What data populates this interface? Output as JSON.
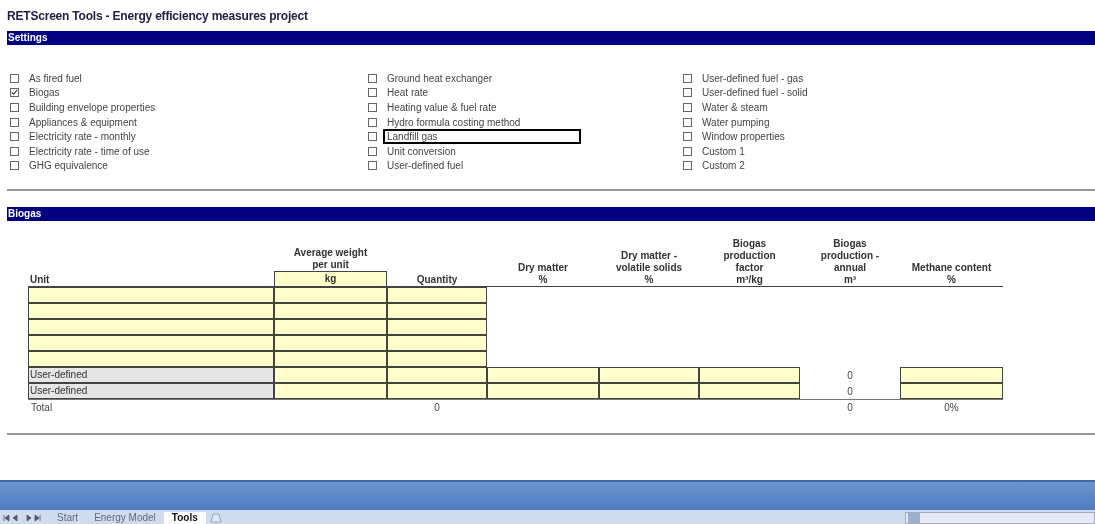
{
  "title": "RETScreen Tools - Energy efficiency measures project",
  "settings": {
    "heading": "Settings",
    "columns": [
      [
        {
          "label": "As fired fuel",
          "checked": false,
          "selected": false
        },
        {
          "label": "Biogas",
          "checked": true,
          "selected": false
        },
        {
          "label": "Building envelope properties",
          "checked": false,
          "selected": false
        },
        {
          "label": "Appliances & equipment",
          "checked": false,
          "selected": false
        },
        {
          "label": "Electricity rate - monthly",
          "checked": false,
          "selected": false
        },
        {
          "label": "Electricity rate - time of use",
          "checked": false,
          "selected": false
        },
        {
          "label": "GHG equivalence",
          "checked": false,
          "selected": false
        }
      ],
      [
        {
          "label": "Ground heat exchanger",
          "checked": false,
          "selected": false
        },
        {
          "label": "Heat rate",
          "checked": false,
          "selected": false
        },
        {
          "label": "Heating value & fuel rate",
          "checked": false,
          "selected": false
        },
        {
          "label": "Hydro formula costing method",
          "checked": false,
          "selected": false
        },
        {
          "label": "Landfill gas",
          "checked": false,
          "selected": true
        },
        {
          "label": "Unit conversion",
          "checked": false,
          "selected": false
        },
        {
          "label": "User-defined fuel",
          "checked": false,
          "selected": false
        }
      ],
      [
        {
          "label": "User-defined fuel - gas",
          "checked": false,
          "selected": false
        },
        {
          "label": "User-defined fuel - solid",
          "checked": false,
          "selected": false
        },
        {
          "label": "Water & steam",
          "checked": false,
          "selected": false
        },
        {
          "label": "Water pumping",
          "checked": false,
          "selected": false
        },
        {
          "label": "Window properties",
          "checked": false,
          "selected": false
        },
        {
          "label": "Custom 1",
          "checked": false,
          "selected": false
        },
        {
          "label": "Custom 2",
          "checked": false,
          "selected": false
        }
      ]
    ]
  },
  "biogas": {
    "heading": "Biogas",
    "columns": [
      {
        "lines": [
          "Unit"
        ]
      },
      {
        "lines": [
          "Average weight",
          "per unit"
        ],
        "unit": "kg"
      },
      {
        "lines": [
          "Quantity"
        ]
      },
      {
        "lines": [
          "Dry matter",
          "%"
        ]
      },
      {
        "lines": [
          "Dry matter -",
          "volatile solids",
          "%"
        ]
      },
      {
        "lines": [
          "Biogas",
          "production",
          "factor",
          "m³/kg"
        ]
      },
      {
        "lines": [
          "Biogas",
          "production -",
          "annual",
          "m³"
        ]
      },
      {
        "lines": [
          "Methane content",
          "%"
        ]
      }
    ],
    "rows": [
      {
        "cells": [
          {
            "kind": "input"
          },
          {
            "kind": "input"
          },
          {
            "kind": "input"
          },
          {
            "kind": "empty"
          },
          {
            "kind": "empty"
          },
          {
            "kind": "empty"
          },
          {
            "kind": "empty"
          },
          {
            "kind": "empty"
          }
        ]
      },
      {
        "cells": [
          {
            "kind": "input"
          },
          {
            "kind": "input"
          },
          {
            "kind": "input"
          },
          {
            "kind": "empty"
          },
          {
            "kind": "empty"
          },
          {
            "kind": "empty"
          },
          {
            "kind": "empty"
          },
          {
            "kind": "empty"
          }
        ]
      },
      {
        "cells": [
          {
            "kind": "input"
          },
          {
            "kind": "input"
          },
          {
            "kind": "input"
          },
          {
            "kind": "empty"
          },
          {
            "kind": "empty"
          },
          {
            "kind": "empty"
          },
          {
            "kind": "empty"
          },
          {
            "kind": "empty"
          }
        ]
      },
      {
        "cells": [
          {
            "kind": "input"
          },
          {
            "kind": "input"
          },
          {
            "kind": "input"
          },
          {
            "kind": "empty"
          },
          {
            "kind": "empty"
          },
          {
            "kind": "empty"
          },
          {
            "kind": "empty"
          },
          {
            "kind": "empty"
          }
        ]
      },
      {
        "cells": [
          {
            "kind": "input"
          },
          {
            "kind": "input"
          },
          {
            "kind": "input"
          },
          {
            "kind": "empty"
          },
          {
            "kind": "empty"
          },
          {
            "kind": "empty"
          },
          {
            "kind": "empty"
          },
          {
            "kind": "empty"
          }
        ]
      },
      {
        "cells": [
          {
            "kind": "label",
            "text": "User-defined"
          },
          {
            "kind": "input"
          },
          {
            "kind": "input"
          },
          {
            "kind": "input"
          },
          {
            "kind": "input"
          },
          {
            "kind": "input"
          },
          {
            "kind": "value",
            "text": "0"
          },
          {
            "kind": "input"
          }
        ]
      },
      {
        "cells": [
          {
            "kind": "label",
            "text": "User-defined"
          },
          {
            "kind": "input"
          },
          {
            "kind": "input"
          },
          {
            "kind": "input"
          },
          {
            "kind": "input"
          },
          {
            "kind": "input"
          },
          {
            "kind": "value",
            "text": "0"
          },
          {
            "kind": "input"
          }
        ]
      },
      {
        "cells": [
          {
            "kind": "value",
            "text": "Total"
          },
          {
            "kind": "empty"
          },
          {
            "kind": "value",
            "text": "0"
          },
          {
            "kind": "empty"
          },
          {
            "kind": "empty"
          },
          {
            "kind": "empty"
          },
          {
            "kind": "value",
            "text": "0"
          },
          {
            "kind": "value",
            "text": "0%"
          }
        ]
      }
    ]
  },
  "sheet_tabs": [
    {
      "label": "Start",
      "selected": false
    },
    {
      "label": "Energy Model",
      "selected": false
    },
    {
      "label": "Tools",
      "selected": true
    }
  ]
}
